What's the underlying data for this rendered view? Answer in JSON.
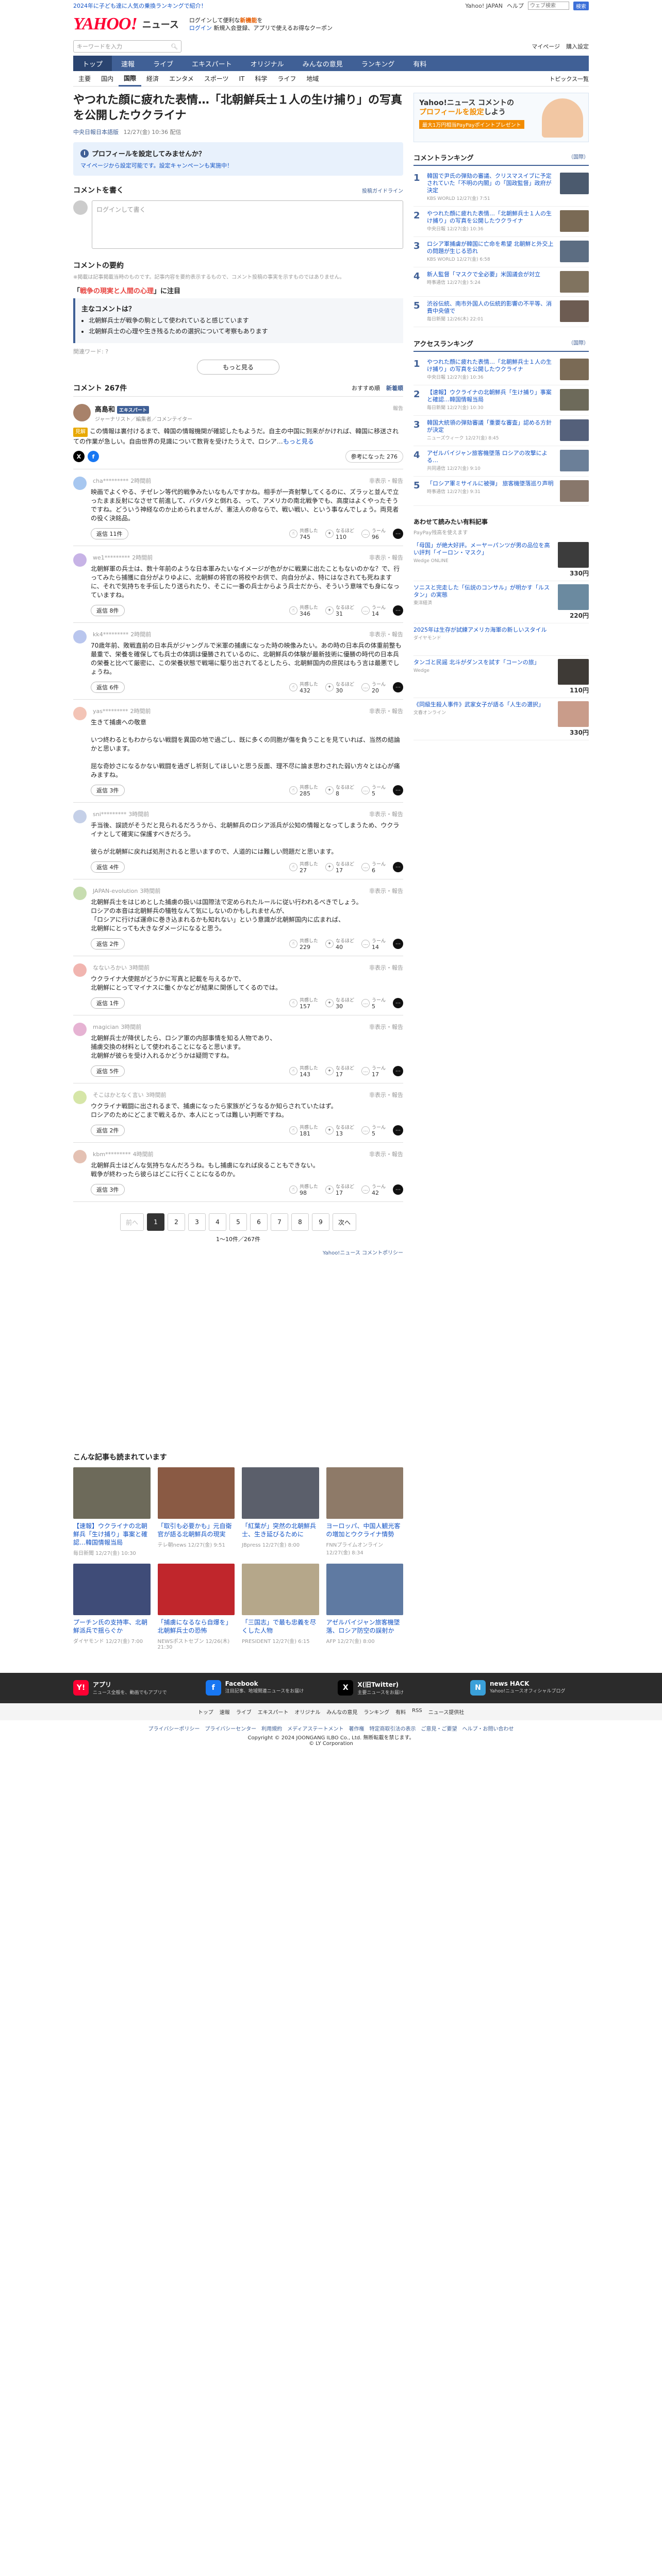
{
  "top_strip": {
    "promo": "2024年に子ども達に人気の乗換ランキングで紹介！",
    "links": [
      "Yahoo! JAPAN",
      "ヘルプ"
    ],
    "search_placeholder": "ウェブ検索",
    "search_btn": "検索"
  },
  "header": {
    "logo": "YAHOO!",
    "logo_sub": "ニュース",
    "promo_line1_pre": "ログインして便利な",
    "promo_line1_hl": "新機能",
    "promo_line1_post": "を",
    "promo_line2": "ログイン",
    "promo_line2b": "新規入会登録、アプリで使えるお得なクーポン"
  },
  "search_row": {
    "placeholder": "キーワードを入力",
    "links": [
      "マイページ",
      "購入設定"
    ]
  },
  "nav": {
    "items": [
      "トップ",
      "速報",
      "ライブ",
      "エキスパート",
      "オリジナル",
      "みんなの意見",
      "ランキング",
      "有料"
    ],
    "active": 0
  },
  "subnav": {
    "items": [
      "主要",
      "国内",
      "国際",
      "経済",
      "エンタメ",
      "スポーツ",
      "IT",
      "科学",
      "ライフ",
      "地域"
    ],
    "active": 2,
    "right": "トピックス一覧"
  },
  "article": {
    "headline": "やつれた顔に疲れた表情…「北朝鮮兵士１人の生け捕り」の写真を公開したウクライナ",
    "source": "中央日報日本語版",
    "time": "12/27(金) 10:36 配信"
  },
  "notice": {
    "title": "プロフィールを設定してみませんか？",
    "desc": "マイページから設定可能です。設定キャンペーンも実施中！"
  },
  "write": {
    "title": "コメントを書く",
    "right": "投稿ガイドライン",
    "placeholder": "ログインして書く"
  },
  "digest": {
    "title": "コメントの要約",
    "note": "※掲載は記事掲載当時のものです。記事内容を要約表示するもので、コメント投稿の事実を示すものではありません。",
    "q_pre": "「",
    "q_hl": "戦争の現実と人間の心理",
    "q_post": "」に注目",
    "points_title": "主なコメントは？",
    "points": [
      "北朝鮮兵士が戦争の駒として使われていると感じています",
      "北朝鮮兵士の心理や生き残るための選択について考察もあります"
    ],
    "keywords": "関連ワード: ?",
    "more": "もっと見る"
  },
  "comments_header": {
    "title": "コメント 267件",
    "sort": [
      "おすすめ順",
      "新着順"
    ],
    "sort_active": 1
  },
  "author": {
    "name": "高島和",
    "badge": "エキスパート",
    "role": "ジャーナリスト／編集者／コメンテイター",
    "label": "報告",
    "tag": "見解",
    "body": "この情報は裏付けるまで、韓国の情報機関が確認したもようだ。自主の中国に到来がかければ、韓国に移送されての作業が急しい。自由世界の見識について数背を受けたうえで、ロシア…",
    "more": "もっと見る",
    "helpful": "参考になった 276"
  },
  "comments": [
    {
      "user": "cha*********",
      "time": "2時間前",
      "report": "非表示・報告",
      "text": "映画でよくやる、チゼレン等代的戦争みたいなもんですかね。相手が一斉射撃してくるのに、ズラッと並んで立ったまま反射になさせて前進して、バタバタと倒れる、って、アメリカの南北戦争でも、高度はよくやったそうですね。どういう神経なのか止められませんが、憲法人の命ならで、戦い戦い、という事なんでしょう。両見者の役く決銘品。",
      "reply": "返信 11件",
      "react": [
        "共感した",
        "なるほど",
        "うーん"
      ],
      "counts": [
        745,
        110,
        96
      ],
      "color": "#a7c7f0"
    },
    {
      "user": "we1*********",
      "time": "2時間前",
      "report": "非表示・報告",
      "text": "北朝鮮軍の兵士は、数十年前のような日本軍みたいなイメージが色がかに戦果に出たこともないのかな？で、行ってみたら捕獲に自分がよりゆよに、北朝鮮の将官の将校やお供で、向自分がよ、特にはなされても死ねますに、それで気持ちを手伝したり送られたり、そこに一番の兵士からよう兵士だから、そういう意味でも身になっていますね。",
      "reply": "返信 8件",
      "react": [
        "共感した",
        "なるほど",
        "うーん"
      ],
      "counts": [
        346,
        31,
        14
      ],
      "color": "#c7b3e6"
    },
    {
      "user": "kk4*********",
      "time": "2時間前",
      "report": "非表示・報告",
      "text": "70歳年前、敗戦直前の日本兵がジャングルで米軍の捕虜になった時の映像みたい。あの時の日本兵の体重前整も最重で、栄養を確保しても兵士の体調は優勝されているのに、北朝鮮兵の体験が最新技術に優勝の時代の日本兵の栄養と比べて厳密に、この栄養状態で戦場に駆り出されてるとしたら、北朝鮮国内の庶民はもう言は最悪でしょうね。",
      "reply": "返信 6件",
      "react": [
        "共感した",
        "なるほど",
        "うーん"
      ],
      "counts": [
        432,
        30,
        20
      ],
      "color": "#b9c6ee"
    },
    {
      "user": "yas*********",
      "time": "2時間前",
      "report": "非表示・報告",
      "text": "生きて捕虜への敬意\n\nいつ終わるともわからない戦闘を異国の地で過ごし、既に多くの同胞が傷を負うことを見ていれば、当然の結論かと思います。\n\n屈な奇妙さになるかない戦闘を過ぎし祈刻してほしいと思う反面、理不尽に論ま思わされた弱い方々とは心が痛みますね。",
      "reply": "返信 3件",
      "react": [
        "共感した",
        "なるほど",
        "うーん"
      ],
      "counts": [
        285,
        8,
        5
      ],
      "color": "#f3c4b6"
    },
    {
      "user": "sni*********",
      "time": "3時間前",
      "report": "非表示・報告",
      "text": "手当後、誤読がそうだと見られるだろうから、北朝鮮兵のロシア派兵が公知の情報となってしまうため、ウクライナとして確実に保護すべきだろう。\n\n彼らが北朝鮮に戻れば処刑されると思いますので、人道的には難しい問題だと思います。",
      "reply": "返信 4件",
      "react": [
        "共感した",
        "なるほど",
        "うーん"
      ],
      "counts": [
        27,
        17,
        6
      ],
      "color": "#c5d0e8"
    },
    {
      "user": "JAPAN-evolution",
      "time": "3時間前",
      "report": "非表示・報告",
      "text": "北朝鮮兵士をはじめとした捕虜の扱いは国際法で定められたルールに従い行われるべきでしょう。\nロシアの本音は北朝鮮兵の犠牲なんて気にしないのかもしれませんが、\n「ロシアに行けば運命に巻き込まれるかも知れない」という意識が北朝鮮国内に広まれば、\n北朝鮮にとっても大きなダメージになると思う。",
      "reply": "返信 2件",
      "react": [
        "共感した",
        "なるほど",
        "うーん"
      ],
      "counts": [
        229,
        40,
        14
      ],
      "color": "#c7ddb0"
    },
    {
      "user": "なないろかい",
      "time": "3時間前",
      "report": "非表示・報告",
      "text": "ウクライナ大使館がどうかに写真と記載を与えるかで、\n北朝鮮にとってマイナスに働くかなどが結果に関係してくるのでは。",
      "reply": "返信 1件",
      "react": [
        "共感した",
        "なるほど",
        "うーん"
      ],
      "counts": [
        157,
        30,
        5
      ],
      "color": "#f1b5b0"
    },
    {
      "user": "magician",
      "time": "3時間前",
      "report": "非表示・報告",
      "text": "北朝鮮兵士が降伏したら、ロシア軍の内部事情を知る人物であり、\n捕虜交換の材料として使われることになると思います。\n北朝鮮が彼らを受け入れるかどうかは疑問ですね。",
      "reply": "返信 5件",
      "react": [
        "共感した",
        "なるほど",
        "うーん"
      ],
      "counts": [
        143,
        17,
        17
      ],
      "color": "#e6b3d3"
    },
    {
      "user": "そこはかとなく言い",
      "time": "3時間前",
      "report": "非表示・報告",
      "text": "ウクライナ戦闘に出されるまで、捕虜になったら家族がどうなるか知らされていたはず。\nロシアのためにどこまで戦えるか、本人にとっては難しい判断ですね。",
      "reply": "返信 2件",
      "react": [
        "共感した",
        "なるほど",
        "うーん"
      ],
      "counts": [
        181,
        13,
        5
      ],
      "color": "#d6e6a8"
    },
    {
      "user": "kbm*********",
      "time": "4時間前",
      "report": "非表示・報告",
      "text": "北朝鮮兵士はどんな気持ちなんだろうね。もし捕虜になれば戻ることもできない。\n戦争が終わったら彼らはどこに行くことになるのか。",
      "reply": "返信 3件",
      "react": [
        "共感した",
        "なるほど",
        "うーん"
      ],
      "counts": [
        98,
        17,
        42
      ],
      "color": "#e4c1b3"
    }
  ],
  "pager": {
    "prev": "前へ",
    "next": "次へ",
    "pages": [
      "1",
      "2",
      "3",
      "4",
      "5",
      "6",
      "7",
      "8",
      "9"
    ],
    "active": 0,
    "range": "1〜10件／267件",
    "policy": "Yahoo!ニュース コメントポリシー"
  },
  "related": {
    "title": "こんな記事も読まれています",
    "items": [
      {
        "t": "【速報】ウクライナの北朝鮮兵「生け捕り」事案と確認…韓国情報当局",
        "m": "毎日新聞 12/27(金) 10:30",
        "color": "#6d6a5a"
      },
      {
        "t": "「取引も必要かも」元自衛官が語る北朝鮮兵の現実",
        "m": "テレ朝news 12/27(金) 9:51",
        "color": "#8a5a44"
      },
      {
        "t": "「紅葉が」突然の北朝鮮兵士、生き延びるために",
        "m": "JBpress 12/27(金) 8:00",
        "color": "#5b5f6b"
      },
      {
        "t": "ヨーロッパ、中国人観光客の増加とウクライナ情勢",
        "m": "FNNプライムオンライン 12/27(金) 8:34",
        "color": "#8e7a68"
      },
      {
        "t": "プーチン氏の支持率、北朝鮮派兵で揺らぐか",
        "m": "ダイヤモンド 12/27(金) 7:00",
        "color": "#3f4c78"
      },
      {
        "t": "「捕虜になるなら自爆を」北朝鮮兵士の恐怖",
        "m": "NEWSポストセブン 12/26(木) 21:30",
        "color": "#c0262c"
      },
      {
        "t": "「三国志」で最も忠義を尽くした人物",
        "m": "PRESIDENT 12/27(金) 6:15",
        "color": "#b5a78a"
      },
      {
        "t": "アゼルバイジャン旅客機墜落、ロシア防空の誤射か",
        "m": "AFP 12/27(金) 8:00",
        "color": "#5f7aa2"
      }
    ]
  },
  "sidebar": {
    "ad": {
      "line1": "Yahoo!ニュース コメントの",
      "line2_hl": "プロフィールを設定",
      "line2_post": "しよう",
      "cta": "最大1万円相当PayPayポイントプレゼント"
    },
    "rank1": {
      "title": "コメントランキング",
      "right": "（国際）",
      "items": [
        {
          "t": "韓国で尹氏の弾劾の審議、クリスマスイブに予定されていた「不明の内閣」の「国政監督」政府が決定",
          "m": "KBS WORLD 12/27(金) 7:51",
          "color": "#4b5a6e"
        },
        {
          "t": "やつれた顔に疲れた表情…「北朝鮮兵士１人の生け捕り」の写真を公開したウクライナ",
          "m": "中央日報 12/27(金) 10:36",
          "color": "#7a6a55"
        },
        {
          "t": "ロシア軍捕虜が韓国に亡命を希望 北朝鮮と外交上の問題が生じる恐れ",
          "m": "KBS WORLD 12/27(金) 6:58",
          "color": "#5c6d82"
        },
        {
          "t": "新人監督「マスクで全必要」米国議会が対立",
          "m": "時事通信 12/27(金) 5:24",
          "color": "#80735f"
        },
        {
          "t": "渋谷伝統、南市外国人の伝統的影響の不平等、消費中央値で",
          "m": "毎日新聞 12/26(木) 22:01",
          "color": "#6d5c52"
        }
      ]
    },
    "rank2": {
      "title": "アクセスランキング",
      "right": "（国際）",
      "items": [
        {
          "t": "やつれた顔に疲れた表情…「北朝鮮兵士１人の生け捕り」の写真を公開したウクライナ",
          "m": "中央日報 12/27(金) 10:36",
          "color": "#7a6a55"
        },
        {
          "t": "【速報】ウクライナの北朝鮮兵「生け捕り」事案と確認…韓国情報当局",
          "m": "毎日新聞 12/27(金) 10:30",
          "color": "#6d6a5a"
        },
        {
          "t": "韓国大統領の弾劾審議「重要な審査」認める方針が決定",
          "m": "ニューズウィーク 12/27(金) 8:45",
          "color": "#54607a"
        },
        {
          "t": "アゼルバイジャン旅客機墜落 ロシアの攻撃による…",
          "m": "共同通信 12/27(金) 9:10",
          "color": "#6b7f98"
        },
        {
          "t": "「ロシア軍ミサイルに被弾」 旅客機墜落巡り声明",
          "m": "時事通信 12/27(金) 9:31",
          "color": "#88776b"
        }
      ]
    },
    "sponsor": {
      "title": "あわせて読みたい有料記事",
      "sub": "PayPay残高を使えます",
      "items": [
        {
          "t": "「母国」が絶大好評。メーヤーパンツが男の品位を高い評判「イーロン・マスク」",
          "m": "Wedge ONLINE",
          "price": "330円",
          "color": "#3c3c3c"
        },
        {
          "t": "ソニスと完走した「伝説のコンサル」が明かす「ルスタン」の実態",
          "m": "東洋経済",
          "price": "220円",
          "color": "#6b8aa0"
        },
        {
          "t": "2025年は生存が試練アメリカ海軍の新しいスタイル",
          "m": "ダイヤモンド",
          "price": "",
          "color": "#ffffff"
        },
        {
          "t": "タンゴと民謡 北斗がダンスを試す「コーンの旅」",
          "m": "Wedge",
          "price": "110円",
          "color": "#3e3a36"
        },
        {
          "t": "《同級生殺人事件》武家女子が語る「人生の選択」",
          "m": "文春オンライン",
          "price": "330円",
          "color": "#c99c8a"
        }
      ]
    }
  },
  "footer": {
    "apps": [
      {
        "n": "アプリ",
        "d": "ニュース全般を、動画でもアプリで",
        "ic": "Y!",
        "bg": "#ff0033"
      },
      {
        "n": "Facebook",
        "d": "注目記事、地域関連ニュースをお届け",
        "ic": "f",
        "bg": "#1877f2"
      },
      {
        "n": "X(旧Twitter)",
        "d": "主要ニュースをお届け",
        "ic": "X",
        "bg": "#000000"
      },
      {
        "n": "news HACK",
        "d": "Yahoo!ニュースオフィシャルブログ",
        "ic": "N",
        "bg": "#3aa0d9"
      }
    ],
    "links1": [
      "トップ",
      "速報",
      "ライブ",
      "エキスパート",
      "オリジナル",
      "みんなの意見",
      "ランキング",
      "有料",
      "RSS",
      "ニュース提供社"
    ],
    "links2": [
      "プライバシーポリシー",
      "プライバシーセンター",
      "利用規約",
      "メディアステートメント",
      "著作権",
      "特定商取引法の表示",
      "ご意見・ご要望",
      "ヘルプ・お問い合わせ"
    ],
    "copyright": "Copyright © 2024 JOONGANG ILBO Co., Ltd. 無断転載を禁じます。",
    "corp": "© LY Corporation"
  }
}
